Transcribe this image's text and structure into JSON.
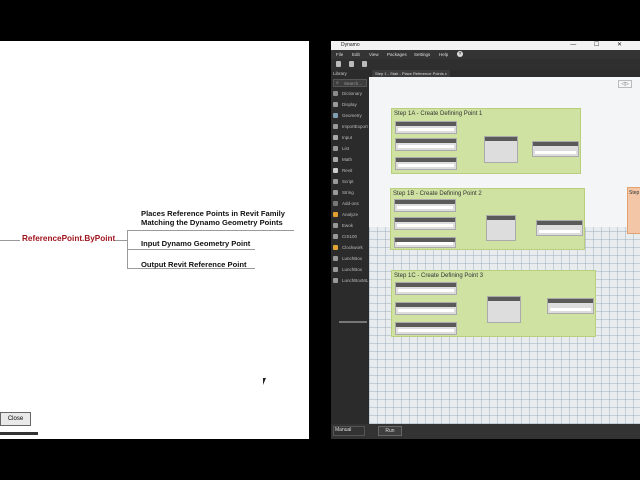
{
  "mindmap": {
    "root": "ReferencePoint.ByPoint",
    "branches": [
      "Places Reference Points in Revit Family\nMatching the Dynamo Geometry Points",
      "Input Dynamo Geometry Point",
      "Output Revit Reference Point"
    ],
    "close_button": "Close"
  },
  "dynamo": {
    "title": "Dynamo",
    "window_controls": "— ☐ ✕",
    "menu": [
      "File",
      "Edit",
      "View",
      "Packages",
      "Settings",
      "Help"
    ],
    "help_icon_glyph": "?",
    "library": {
      "header": "Library",
      "search_placeholder": "Search...",
      "items": [
        {
          "label": "Dictionary",
          "icon": "dictionary-icon"
        },
        {
          "label": "Display",
          "icon": "display-icon"
        },
        {
          "label": "Geometry",
          "icon": "geometry-icon"
        },
        {
          "label": "ImportExport",
          "icon": "import-export-icon"
        },
        {
          "label": "Input",
          "icon": "input-icon"
        },
        {
          "label": "List",
          "icon": "list-icon"
        },
        {
          "label": "Math",
          "icon": "math-icon"
        },
        {
          "label": "Revit",
          "icon": "revit-icon"
        },
        {
          "label": "Script",
          "icon": "script-icon"
        },
        {
          "label": "String",
          "icon": "string-icon"
        },
        {
          "label": "Add-ons",
          "icon": "add-ons-icon"
        },
        {
          "label": "Analyze",
          "icon": "analyze-icon"
        },
        {
          "label": "Ewok",
          "icon": "ewok-icon"
        },
        {
          "label": "CIS100",
          "icon": "cis100-icon"
        },
        {
          "label": "Clockwork",
          "icon": "clockwork-icon"
        },
        {
          "label": "LunchBox",
          "icon": "lunchbox-icon"
        },
        {
          "label": "LunchBox",
          "icon": "lunchbox-icon"
        },
        {
          "label": "LunchBoxML",
          "icon": "lunchboxml-icon"
        }
      ]
    },
    "tab": "Step 1 - Stair - Place Reference Points x",
    "view_toggle": "◁▷",
    "groups": [
      {
        "title": "Step 1A - Create Defining Point 1"
      },
      {
        "title": "Step 1B - Create Defining Point 2"
      },
      {
        "title": "Step 1C - Create Defining Point 3"
      }
    ],
    "side_group_title": "Step",
    "run_mode": "Manual",
    "run_button": "Run"
  }
}
